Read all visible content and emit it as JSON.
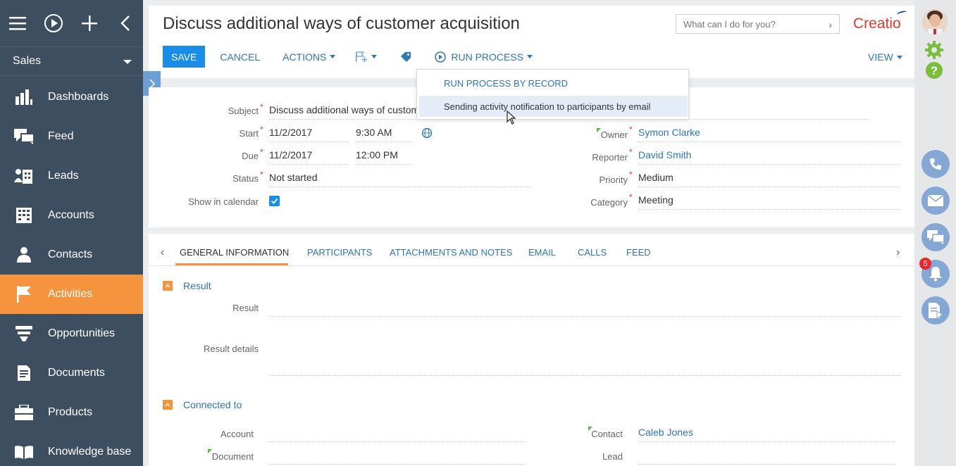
{
  "sidebar": {
    "section": "Sales",
    "items": [
      {
        "label": "Dashboards",
        "icon": "bar-chart-icon"
      },
      {
        "label": "Feed",
        "icon": "feed-icon"
      },
      {
        "label": "Leads",
        "icon": "leads-icon"
      },
      {
        "label": "Accounts",
        "icon": "building-icon"
      },
      {
        "label": "Contacts",
        "icon": "person-icon"
      },
      {
        "label": "Activities",
        "icon": "flag-icon",
        "active": true
      },
      {
        "label": "Opportunities",
        "icon": "funnel-icon"
      },
      {
        "label": "Documents",
        "icon": "document-icon"
      },
      {
        "label": "Products",
        "icon": "products-icon"
      },
      {
        "label": "Knowledge base",
        "icon": "book-icon"
      }
    ]
  },
  "header": {
    "title": "Discuss additional ways of customer acquisition",
    "search_placeholder": "What can I do for you?",
    "logo": "Creatio"
  },
  "toolbar": {
    "save": "SAVE",
    "cancel": "CANCEL",
    "actions": "ACTIONS",
    "run_process": "RUN PROCESS",
    "view": "VIEW"
  },
  "run_process_menu": {
    "items": [
      "RUN PROCESS BY RECORD",
      "Sending activity notification to participants by email"
    ]
  },
  "fields": {
    "subject_label": "Subject",
    "subject_value": "Discuss additional ways of custome",
    "start_label": "Start",
    "start_date": "11/2/2017",
    "start_time": "9:30 AM",
    "due_label": "Due",
    "due_date": "11/2/2017",
    "due_time": "12:00 PM",
    "status_label": "Status",
    "status_value": "Not started",
    "calendar_label": "Show in calendar",
    "owner_label": "Owner",
    "owner_value": "Symon Clarke",
    "reporter_label": "Reporter",
    "reporter_value": "David Smith",
    "priority_label": "Priority",
    "priority_value": "Medium",
    "category_label": "Category",
    "category_value": "Meeting"
  },
  "tabs": [
    "GENERAL INFORMATION",
    "PARTICIPANTS",
    "ATTACHMENTS AND NOTES",
    "EMAIL",
    "CALLS",
    "FEED"
  ],
  "groups": {
    "result_title": "Result",
    "result_label": "Result",
    "result_details_label": "Result details",
    "connected_title": "Connected to",
    "account_label": "Account",
    "contact_label": "Contact",
    "contact_value": "Caleb Jones",
    "document_label": "Document",
    "lead_label": "Lead"
  },
  "notifications": {
    "count": "5"
  },
  "colors": {
    "sidebar": "#3d4e61",
    "active": "#f5943c",
    "primary": "#1a8ee6",
    "link": "#2f75b7"
  }
}
